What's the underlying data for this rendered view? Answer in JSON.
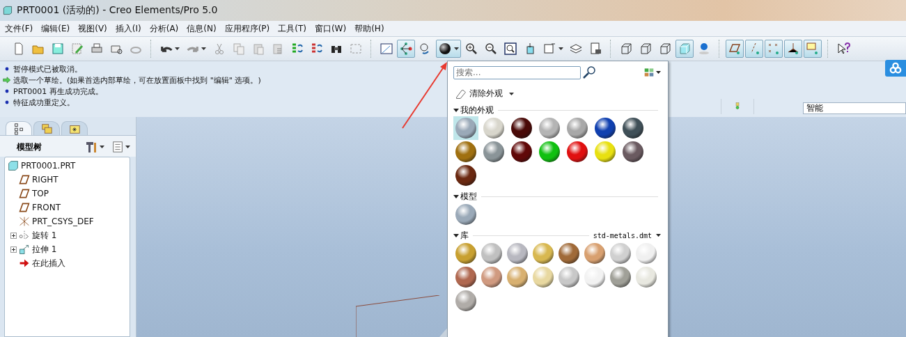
{
  "window": {
    "title": "PRT0001 (活动的) - Creo Elements/Pro 5.0"
  },
  "menu": [
    "文件(F)",
    "编辑(E)",
    "视图(V)",
    "插入(I)",
    "分析(A)",
    "信息(N)",
    "应用程序(P)",
    "工具(T)",
    "窗口(W)",
    "帮助(H)"
  ],
  "toolbar": [
    {
      "kind": "new",
      "pressed": false
    },
    {
      "kind": "open",
      "pressed": false
    },
    {
      "kind": "save",
      "pressed": false
    },
    {
      "kind": "edit",
      "pressed": false
    },
    {
      "kind": "print",
      "pressed": false
    },
    {
      "kind": "mail",
      "pressed": false
    },
    {
      "kind": "link",
      "pressed": false
    },
    {
      "kind": "sep"
    },
    {
      "kind": "undo",
      "pressed": false
    },
    {
      "kind": "redo",
      "pressed": false
    },
    {
      "kind": "cut",
      "pressed": false
    },
    {
      "kind": "copy",
      "pressed": false
    },
    {
      "kind": "paste",
      "pressed": false
    },
    {
      "kind": "paste-special",
      "pressed": false
    },
    {
      "kind": "regen",
      "pressed": false
    },
    {
      "kind": "regen2",
      "pressed": false
    },
    {
      "kind": "find",
      "pressed": false
    },
    {
      "kind": "select",
      "pressed": false
    },
    {
      "kind": "sep"
    },
    {
      "kind": "sketch",
      "pressed": false
    },
    {
      "kind": "tree",
      "pressed": true
    },
    {
      "kind": "model",
      "pressed": false
    },
    {
      "kind": "sphere",
      "pressed": true
    },
    {
      "kind": "zoom-in",
      "pressed": false
    },
    {
      "kind": "zoom-out",
      "pressed": false
    },
    {
      "kind": "refit",
      "pressed": false
    },
    {
      "kind": "orient",
      "pressed": false
    },
    {
      "kind": "views",
      "pressed": false
    },
    {
      "kind": "layers",
      "pressed": false
    },
    {
      "kind": "camera",
      "pressed": false
    },
    {
      "kind": "sep"
    },
    {
      "kind": "cube",
      "pressed": false
    },
    {
      "kind": "cube",
      "pressed": false
    },
    {
      "kind": "cube",
      "pressed": false
    },
    {
      "kind": "shade",
      "pressed": true
    },
    {
      "kind": "spin",
      "pressed": false
    },
    {
      "kind": "sep"
    },
    {
      "kind": "plane",
      "pressed": true
    },
    {
      "kind": "axis",
      "pressed": true
    },
    {
      "kind": "point",
      "pressed": true
    },
    {
      "kind": "csys",
      "pressed": true
    },
    {
      "kind": "note",
      "pressed": true
    },
    {
      "kind": "sep"
    },
    {
      "kind": "help",
      "pressed": false
    }
  ],
  "messages": [
    {
      "kind": "info",
      "text": "暂停模式已被取消。"
    },
    {
      "kind": "prompt",
      "text": "选取一个草绘。(如果首选内部草绘，可在放置面板中找到 \"编辑\" 选项。)"
    },
    {
      "kind": "info",
      "text": "PRT0001 再生成功完成。"
    },
    {
      "kind": "info",
      "text": "特征成功重定义。"
    }
  ],
  "filter": {
    "value": "智能"
  },
  "model_tree": {
    "tabs": [
      {
        "kind": "tree",
        "selected": true
      },
      {
        "kind": "folders",
        "selected": false
      },
      {
        "kind": "favorites",
        "selected": false
      }
    ],
    "title": "模型树",
    "items": [
      {
        "label": "PRT0001.PRT",
        "kind": "part",
        "children": [
          {
            "label": "RIGHT",
            "kind": "plane"
          },
          {
            "label": "TOP",
            "kind": "plane"
          },
          {
            "label": "FRONT",
            "kind": "plane"
          },
          {
            "label": "PRT_CSYS_DEF",
            "kind": "csys"
          },
          {
            "label": "旋转 1",
            "kind": "revolve",
            "expanded": false
          },
          {
            "label": "拉伸 1",
            "kind": "extrude",
            "expanded": false
          },
          {
            "label": "在此插入",
            "kind": "insert"
          }
        ]
      }
    ]
  },
  "appearance_gallery": {
    "search": {
      "placeholder": "搜索..."
    },
    "clear_button": "清除外观",
    "sections": [
      {
        "title": "我的外观",
        "expanded": true,
        "swatches": [
          {
            "color": "#9aa9b8",
            "selected": true
          },
          {
            "color": "#d8d6cc",
            "selected": false
          },
          {
            "color": "#4a0a08",
            "selected": false
          },
          {
            "color": "#b4b4b4",
            "selected": false
          },
          {
            "color": "#a8a8a8",
            "selected": false
          },
          {
            "color": "#1040b0",
            "selected": false
          },
          {
            "color": "#405058",
            "selected": false
          },
          {
            "color": "#a07010",
            "selected": false
          },
          {
            "color": "#8a9498",
            "selected": false
          },
          {
            "color": "#600808",
            "selected": false
          },
          {
            "color": "#10c010",
            "selected": false
          },
          {
            "color": "#e01010",
            "selected": false
          },
          {
            "color": "#e8e010",
            "selected": false
          },
          {
            "color": "#6a5a60",
            "selected": false
          },
          {
            "color": "#6a2810",
            "selected": false
          }
        ]
      },
      {
        "title": "模型",
        "expanded": true,
        "swatches": [
          {
            "color": "#9aa9b8",
            "selected": false
          }
        ]
      },
      {
        "title": "库",
        "expanded": true,
        "library": "std-metals.dmt",
        "swatches": [
          {
            "color": "#c8a030",
            "selected": false
          },
          {
            "color": "#c0c0c0",
            "selected": false
          },
          {
            "color": "#b8b8c0",
            "selected": false
          },
          {
            "color": "#d8b850",
            "selected": false
          },
          {
            "color": "#a06a38",
            "selected": false
          },
          {
            "color": "#d8a070",
            "selected": false
          },
          {
            "color": "#d0d0d0",
            "selected": false
          },
          {
            "color": "#f0f0f0",
            "selected": false
          },
          {
            "color": "#b06850",
            "selected": false
          },
          {
            "color": "#d09a80",
            "selected": false
          },
          {
            "color": "#d8b070",
            "selected": false
          },
          {
            "color": "#e8d8a0",
            "selected": false
          },
          {
            "color": "#c8c8c8",
            "selected": false
          },
          {
            "color": "#f2f2f2",
            "selected": false
          },
          {
            "color": "#a0a098",
            "selected": false
          },
          {
            "color": "#e8e8e0",
            "selected": false
          },
          {
            "color": "#b0aca8",
            "selected": false
          }
        ]
      }
    ]
  }
}
